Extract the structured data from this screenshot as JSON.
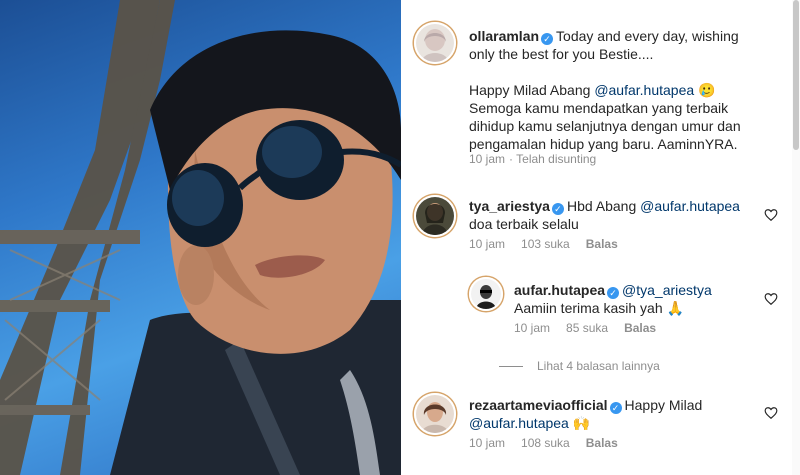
{
  "post": {
    "username": "ollaramlan",
    "caption_line1": "Today and every day, wishing",
    "caption_line2": "only the best for you Bestie....",
    "para2_prefix": "Happy Milad Abang ",
    "para2_mention": "@aufar.hutapea",
    "para2_emoji": "🥲",
    "para3_line1": "Semoga kamu mendapatkan yang terbaik",
    "para3_line2": "dihidup kamu selanjutnya dengan umur dan",
    "para3_line3": "pengamalan hidup yang baru. AaminnYRA.",
    "time": "10 jam",
    "edited": "· Telah disunting"
  },
  "comments": [
    {
      "username": "tya_ariestya",
      "prefix": "Hbd Abang ",
      "mention": "@aufar.hutapea",
      "line2": "doa terbaik selalu",
      "time": "10 jam",
      "likes": "103 suka",
      "reply_label": "Balas"
    },
    {
      "username": "aufar.hutapea",
      "mention": "@tya_ariestya",
      "line2": "Aamiin terima kasih yah 🙏",
      "time": "10 jam",
      "likes": "85 suka",
      "reply_label": "Balas"
    },
    {
      "username": "rezaartameviaofficial",
      "text": "Happy Milad",
      "mention": "@aufar.hutapea",
      "emoji": "🙌",
      "time": "10 jam",
      "likes": "108 suka",
      "reply_label": "Balas"
    }
  ],
  "view_replies_label": "Lihat 4 balasan lainnya",
  "icons": {
    "verified": "verified-badge-icon",
    "like": "heart-icon"
  },
  "colors": {
    "mention": "#00376b",
    "verified": "#3897f0",
    "meta": "#8e8e8e"
  }
}
